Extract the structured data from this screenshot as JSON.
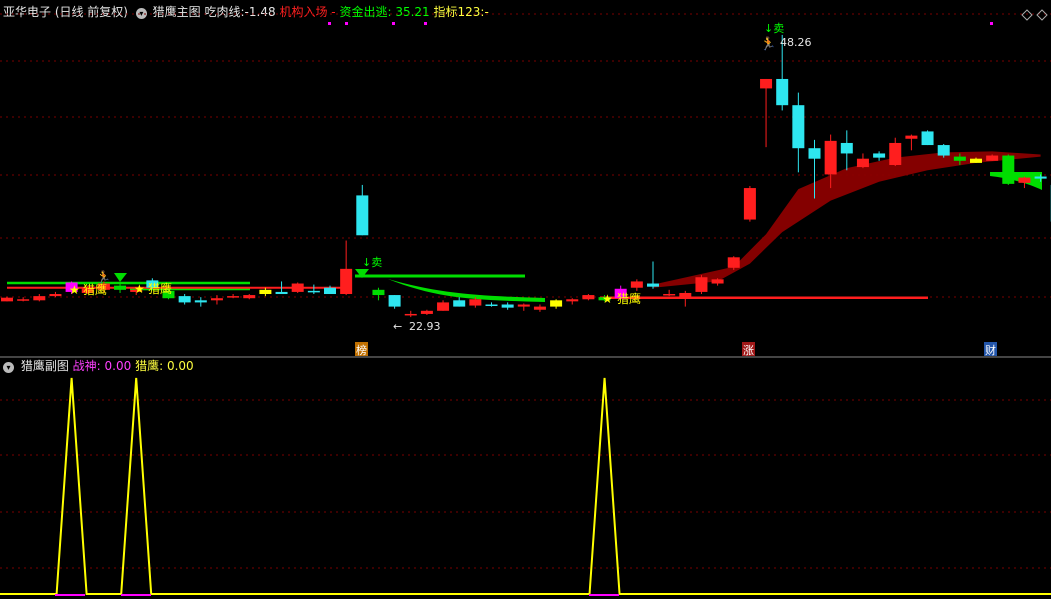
{
  "header": {
    "stock_title": "亚华电子 (日线 前复权)",
    "main_indicator": "猎鹰主图",
    "l_chirou": "吃肉线:",
    "v_chirou": "-1.48",
    "l_jigou": "机构入场",
    "v_jigou": "-",
    "l_zijin": "资金出逃:",
    "v_zijin": "35.21",
    "l_zhibiao": "指标123:",
    "v_zhibiao": "-"
  },
  "sub_header": {
    "indicator": "猎鹰副图",
    "l_zhanshen": "战神:",
    "v_zhanshen": "0.00",
    "l_lieying": "猎鹰:",
    "v_lieying": "0.00"
  },
  "annotations": {
    "high_value": "48.26",
    "low_value": "22.93",
    "sell_label": "↓卖",
    "lieying_label": "猎鹰",
    "badges": [
      "榜",
      "涨",
      "财"
    ]
  },
  "colors": {
    "up": "#ff1e1e",
    "down": "#2ee6f0",
    "green": "#00dd00",
    "yellow": "#ffff00",
    "magenta": "#ff00ff",
    "darkred": "#8b0000",
    "grid": "#7a0000"
  },
  "chart_data": {
    "type": "candlestick",
    "candles": [
      {
        "o": 23.25,
        "h": 23.35,
        "l": 22.9,
        "c": 22.9,
        "k": "up"
      },
      {
        "o": 23.1,
        "h": 23.3,
        "l": 22.9,
        "c": 23.0,
        "k": "up"
      },
      {
        "o": 23.0,
        "h": 23.6,
        "l": 22.9,
        "c": 23.4,
        "k": "up"
      },
      {
        "o": 23.4,
        "h": 23.8,
        "l": 23.3,
        "c": 23.6,
        "k": "up"
      },
      {
        "o": 23.8,
        "h": 24.8,
        "l": 23.6,
        "c": 24.7,
        "k": "magenta"
      },
      {
        "o": 24.2,
        "h": 24.4,
        "l": 23.6,
        "c": 23.7,
        "k": "up"
      },
      {
        "o": 24.0,
        "h": 24.8,
        "l": 23.7,
        "c": 24.6,
        "k": "up"
      },
      {
        "o": 24.0,
        "h": 24.6,
        "l": 23.7,
        "c": 24.4,
        "k": "green"
      },
      {
        "o": 24.0,
        "h": 24.2,
        "l": 23.5,
        "c": 23.8,
        "k": "up"
      },
      {
        "o": 24.9,
        "h": 25.1,
        "l": 24.1,
        "c": 24.2,
        "k": "down"
      },
      {
        "o": 23.9,
        "h": 24.1,
        "l": 23.1,
        "c": 23.2,
        "k": "green"
      },
      {
        "o": 23.4,
        "h": 23.6,
        "l": 22.6,
        "c": 22.8,
        "k": "down"
      },
      {
        "o": 23.0,
        "h": 23.3,
        "l": 22.4,
        "c": 22.8,
        "k": "down"
      },
      {
        "o": 23.0,
        "h": 23.5,
        "l": 22.6,
        "c": 23.2,
        "k": "up"
      },
      {
        "o": 23.4,
        "h": 23.6,
        "l": 23.2,
        "c": 23.4,
        "k": "up"
      },
      {
        "o": 23.2,
        "h": 23.6,
        "l": 23.1,
        "c": 23.5,
        "k": "up"
      },
      {
        "o": 23.6,
        "h": 24.2,
        "l": 23.4,
        "c": 24.0,
        "k": "yellow"
      },
      {
        "o": 23.8,
        "h": 24.8,
        "l": 23.6,
        "c": 23.6,
        "k": "down"
      },
      {
        "o": 23.8,
        "h": 24.7,
        "l": 23.7,
        "c": 24.6,
        "k": "up"
      },
      {
        "o": 23.8,
        "h": 24.5,
        "l": 23.6,
        "c": 23.9,
        "k": "down"
      },
      {
        "o": 23.6,
        "h": 24.4,
        "l": 23.6,
        "c": 24.2,
        "k": "down"
      },
      {
        "o": 23.6,
        "h": 28.7,
        "l": 23.5,
        "c": 26.0,
        "k": "up"
      },
      {
        "o": 33.0,
        "h": 34.0,
        "l": 29.2,
        "c": 29.2,
        "k": "down"
      },
      {
        "o": 24.0,
        "h": 24.2,
        "l": 23.0,
        "c": 23.5,
        "k": "green"
      },
      {
        "o": 23.5,
        "h": 23.5,
        "l": 22.2,
        "c": 22.4,
        "k": "down"
      },
      {
        "o": 21.7,
        "h": 22.0,
        "l": 21.4,
        "c": 21.7,
        "k": "up"
      },
      {
        "o": 21.7,
        "h": 22.1,
        "l": 21.6,
        "c": 22.0,
        "k": "up"
      },
      {
        "o": 22.0,
        "h": 23.0,
        "l": 22.0,
        "c": 22.8,
        "k": "up"
      },
      {
        "o": 23.0,
        "h": 23.3,
        "l": 22.4,
        "c": 22.4,
        "k": "down"
      },
      {
        "o": 22.5,
        "h": 23.3,
        "l": 22.3,
        "c": 23.1,
        "k": "up"
      },
      {
        "o": 22.6,
        "h": 22.8,
        "l": 22.4,
        "c": 22.6,
        "k": "down"
      },
      {
        "o": 22.6,
        "h": 22.8,
        "l": 22.1,
        "c": 22.3,
        "k": "down"
      },
      {
        "o": 22.4,
        "h": 22.7,
        "l": 22.0,
        "c": 22.6,
        "k": "up"
      },
      {
        "o": 22.1,
        "h": 22.6,
        "l": 21.9,
        "c": 22.4,
        "k": "up"
      },
      {
        "o": 22.4,
        "h": 23.1,
        "l": 22.2,
        "c": 23.0,
        "k": "yellow"
      },
      {
        "o": 22.9,
        "h": 23.2,
        "l": 22.6,
        "c": 23.1,
        "k": "up"
      },
      {
        "o": 23.1,
        "h": 23.6,
        "l": 23.0,
        "c": 23.5,
        "k": "up"
      },
      {
        "o": 23.3,
        "h": 23.5,
        "l": 22.9,
        "c": 23.0,
        "k": "green"
      },
      {
        "o": 23.2,
        "h": 24.4,
        "l": 23.1,
        "c": 24.1,
        "k": "magenta"
      },
      {
        "o": 24.2,
        "h": 25.0,
        "l": 23.9,
        "c": 24.8,
        "k": "up"
      },
      {
        "o": 24.6,
        "h": 26.7,
        "l": 24.1,
        "c": 24.3,
        "k": "down"
      },
      {
        "o": 23.6,
        "h": 24.0,
        "l": 23.4,
        "c": 23.6,
        "k": "up"
      },
      {
        "o": 23.2,
        "h": 23.9,
        "l": 22.4,
        "c": 23.7,
        "k": "up"
      },
      {
        "o": 23.8,
        "h": 25.4,
        "l": 23.6,
        "c": 25.2,
        "k": "up"
      },
      {
        "o": 24.6,
        "h": 25.1,
        "l": 24.4,
        "c": 25.0,
        "k": "up"
      },
      {
        "o": 26.1,
        "h": 27.2,
        "l": 25.9,
        "c": 27.1,
        "k": "up"
      },
      {
        "o": 30.7,
        "h": 33.9,
        "l": 30.5,
        "c": 33.7,
        "k": "up"
      },
      {
        "o": 43.2,
        "h": 44.1,
        "l": 37.6,
        "c": 44.1,
        "k": "up"
      },
      {
        "o": 44.1,
        "h": 48.3,
        "l": 41.1,
        "c": 41.6,
        "k": "down"
      },
      {
        "o": 41.6,
        "h": 42.8,
        "l": 35.2,
        "c": 37.5,
        "k": "down"
      },
      {
        "o": 37.5,
        "h": 38.3,
        "l": 32.7,
        "c": 36.5,
        "k": "down"
      },
      {
        "o": 35.0,
        "h": 38.8,
        "l": 33.7,
        "c": 38.2,
        "k": "up"
      },
      {
        "o": 38.0,
        "h": 39.2,
        "l": 35.4,
        "c": 37.0,
        "k": "down"
      },
      {
        "o": 35.7,
        "h": 37.0,
        "l": 35.6,
        "c": 36.5,
        "k": "up"
      },
      {
        "o": 37.0,
        "h": 37.2,
        "l": 36.3,
        "c": 36.6,
        "k": "down"
      },
      {
        "o": 35.9,
        "h": 38.5,
        "l": 35.8,
        "c": 38.0,
        "k": "up"
      },
      {
        "o": 38.4,
        "h": 38.8,
        "l": 37.3,
        "c": 38.7,
        "k": "up"
      },
      {
        "o": 39.1,
        "h": 39.2,
        "l": 37.8,
        "c": 37.8,
        "k": "down"
      },
      {
        "o": 37.8,
        "h": 37.9,
        "l": 36.6,
        "c": 36.8,
        "k": "down"
      },
      {
        "o": 36.7,
        "h": 37.0,
        "l": 35.9,
        "c": 36.3,
        "k": "green"
      },
      {
        "o": 36.1,
        "h": 36.6,
        "l": 36.1,
        "c": 36.5,
        "k": "yellow"
      },
      {
        "o": 36.3,
        "h": 36.9,
        "l": 36.3,
        "c": 36.8,
        "k": "up"
      },
      {
        "o": 36.8,
        "h": 36.9,
        "l": 34.0,
        "c": 34.1,
        "k": "green"
      },
      {
        "o": 34.2,
        "h": 34.8,
        "l": 33.7,
        "c": 34.7,
        "k": "up"
      },
      {
        "o": 34.8,
        "h": 35.0,
        "l": 34.3,
        "c": 34.6,
        "k": "down"
      },
      {
        "o": 34.0,
        "h": 34.0,
        "l": 30.5,
        "c": 30.5,
        "k": "down"
      }
    ],
    "ribbon_upper": [
      [
        20,
        36.35
      ],
      [
        25,
        36.5
      ],
      [
        30,
        36.7
      ],
      [
        35,
        36.85
      ],
      [
        40,
        36.95
      ],
      [
        45,
        37.0
      ],
      [
        50,
        37.0
      ],
      [
        55,
        37.05
      ],
      [
        60,
        37.05
      ],
      [
        64,
        37.05
      ],
      [
        65,
        36.9
      ]
    ],
    "ribbon_lower": [
      [
        20,
        35.0
      ],
      [
        25,
        35.3
      ],
      [
        30,
        35.6
      ],
      [
        35,
        36.0
      ],
      [
        40,
        36.3
      ],
      [
        45,
        36.5
      ],
      [
        50,
        36.55
      ],
      [
        55,
        36.6
      ],
      [
        60,
        36.65
      ],
      [
        64,
        36.7
      ],
      [
        65,
        36.5
      ]
    ],
    "red_line_1": [
      [
        0,
        24.2
      ],
      [
        21,
        24.2
      ]
    ],
    "red_line_2": [
      [
        37,
        23.25
      ],
      [
        57,
        23.25
      ]
    ],
    "sub_chart": {
      "type": "line",
      "series": [
        {
          "values": [
            0,
            0,
            0,
            0,
            1,
            0,
            0,
            0,
            1,
            0,
            0,
            0,
            0,
            0,
            0,
            0,
            0,
            0,
            0,
            0,
            0,
            0,
            0,
            0,
            0,
            0,
            0,
            0,
            0,
            0,
            0,
            0,
            0,
            0,
            0,
            0,
            0,
            1,
            0,
            0,
            0,
            0,
            0,
            0,
            0,
            0,
            0,
            0,
            0,
            0,
            0,
            0,
            0,
            0,
            0,
            0,
            0,
            0,
            0,
            0,
            0,
            0,
            0,
            0,
            0,
            0
          ]
        }
      ]
    }
  }
}
